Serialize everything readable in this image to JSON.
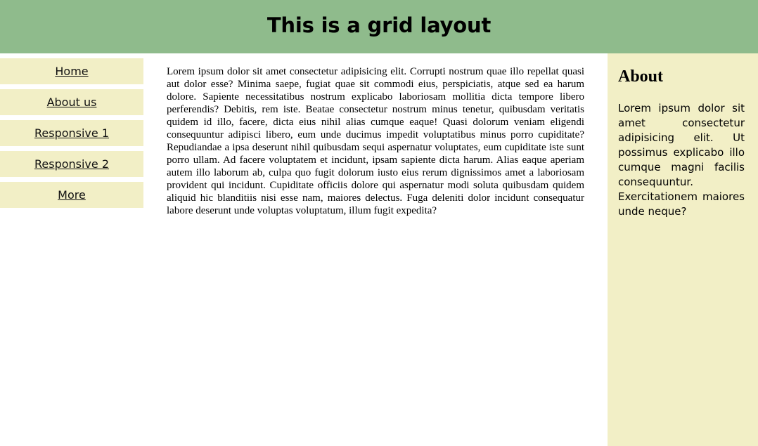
{
  "header": {
    "title": "This is a grid layout"
  },
  "nav": {
    "items": [
      {
        "label": "Home"
      },
      {
        "label": "About us"
      },
      {
        "label": "Responsive 1"
      },
      {
        "label": "Responsive 2"
      },
      {
        "label": "More"
      }
    ]
  },
  "main": {
    "text": "Lorem ipsum dolor sit amet consectetur adipisicing elit. Corrupti nostrum quae illo repellat quasi aut dolor esse? Minima saepe, fugiat quae sit commodi eius, perspiciatis, atque sed ea harum dolore. Sapiente necessitatibus nostrum explicabo laboriosam mollitia dicta tempore libero perferendis? Debitis, rem iste. Beatae consectetur nostrum minus tenetur, quibusdam veritatis quidem id illo, facere, dicta eius nihil alias cumque eaque! Quasi dolorum veniam eligendi consequuntur adipisci libero, eum unde ducimus impedit voluptatibus minus porro cupiditate? Repudiandae a ipsa deserunt nihil quibusdam sequi aspernatur voluptates, eum cupiditate iste sunt porro ullam. Ad facere voluptatem et incidunt, ipsam sapiente dicta harum. Alias eaque aperiam autem illo laborum ab, culpa quo fugit dolorum iusto eius rerum dignissimos amet a laboriosam provident qui incidunt. Cupiditate officiis dolore qui aspernatur modi soluta quibusdam quidem aliquid hic blanditiis nisi esse nam, maiores delectus. Fuga deleniti dolor incidunt consequatur labore deserunt unde voluptas voluptatum, illum fugit expedita?"
  },
  "aside": {
    "title": "About",
    "text": "Lorem ipsum dolor sit amet consectetur adipisicing elit. Ut possimus explicabo illo cumque magni facilis consequuntur. Exercitationem maiores unde neque?"
  },
  "colors": {
    "header_bg": "#8fbb8c",
    "panel_bg": "#f2efc6",
    "page_bg": "#ffffff",
    "text": "#000000"
  }
}
